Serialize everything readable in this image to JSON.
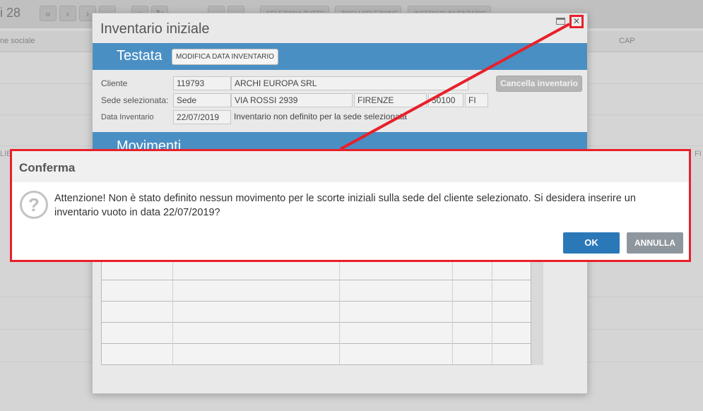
{
  "background": {
    "page_counter": "i 28",
    "toolbar_buttons": {
      "first": "«",
      "prev": "‹",
      "next": "›",
      "last": "»",
      "search": "○",
      "refresh": "↻"
    },
    "toolbar_text_buttons": [
      "SELEZIONA TUTTO",
      "TOGLI SELEZIONE",
      "INSERISCI INVENTARIO"
    ],
    "columns": [
      "ne sociale",
      "CAP"
    ],
    "left_edge_text": "LIE",
    "right_edge_text": "FI"
  },
  "inventario": {
    "title": "Inventario iniziale",
    "maximize_icon": "maximize-icon",
    "close_icon": "close-icon",
    "close_glyph": "✕",
    "testata": {
      "section_title": "Testata",
      "modify_date_button": "MODIFICA DATA INVENTARIO",
      "cliente_label": "Cliente",
      "cliente_code": "119793",
      "cliente_name": "ARCHI EUROPA SRL",
      "sede_label": "Sede selezionata:",
      "sede_value": "Sede",
      "sede_address": "VIA ROSSI 2939",
      "sede_city": "FIRENZE",
      "sede_cap": "50100",
      "sede_province": "FI",
      "data_label": "Data Inventario",
      "data_value": "22/07/2019",
      "data_note": "Inventario non definito per la sede selezionata",
      "cancel_button": "Cancella inventario"
    },
    "movimenti": {
      "section_title": "Movimenti"
    }
  },
  "dialog": {
    "title": "Conferma",
    "icon": "question-icon",
    "icon_glyph": "?",
    "message": "Attenzione! Non è stato definito nessun movimento per le scorte iniziali sulla sede del cliente selezionato. Si desidera inserire un inventario vuoto in data 22/07/2019?",
    "ok_button": "OK",
    "cancel_button": "ANNULLA"
  },
  "colors": {
    "accent_blue": "#4a8fc4",
    "ok_blue": "#2b78b8",
    "annotation_red": "#e8202a",
    "annulla_gray": "#8f979e"
  }
}
